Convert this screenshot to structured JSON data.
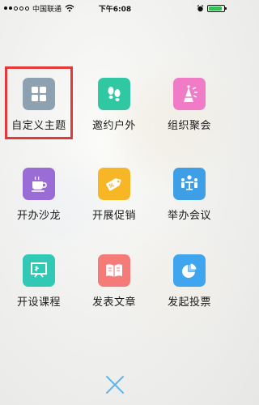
{
  "status_bar": {
    "carrier": "中国联通",
    "time": "下午6:08",
    "battery_percent": 0.8
  },
  "menu": {
    "items": [
      {
        "label": "自定义主题",
        "icon": "grid-icon",
        "color": "#8ea1b1",
        "highlighted": true
      },
      {
        "label": "邀约户外",
        "icon": "footprints-icon",
        "color": "#2fc8a3"
      },
      {
        "label": "组织聚会",
        "icon": "party-icon",
        "color": "#f07bc7"
      },
      {
        "label": "开办沙龙",
        "icon": "coffee-cup-icon",
        "color": "#9a6cd6"
      },
      {
        "label": "开展促销",
        "icon": "discount-tag-icon",
        "color": "#f7b626"
      },
      {
        "label": "举办会议",
        "icon": "meeting-icon",
        "color": "#3f9fe6"
      },
      {
        "label": "开设课程",
        "icon": "presentation-board-icon",
        "color": "#31c9b5"
      },
      {
        "label": "发表文章",
        "icon": "book-icon",
        "color": "#f47b78"
      },
      {
        "label": "发起投票",
        "icon": "pie-chart-icon",
        "color": "#3ea5ee"
      }
    ]
  },
  "close_icon": "close-icon",
  "highlight_color": "#e23a3a"
}
